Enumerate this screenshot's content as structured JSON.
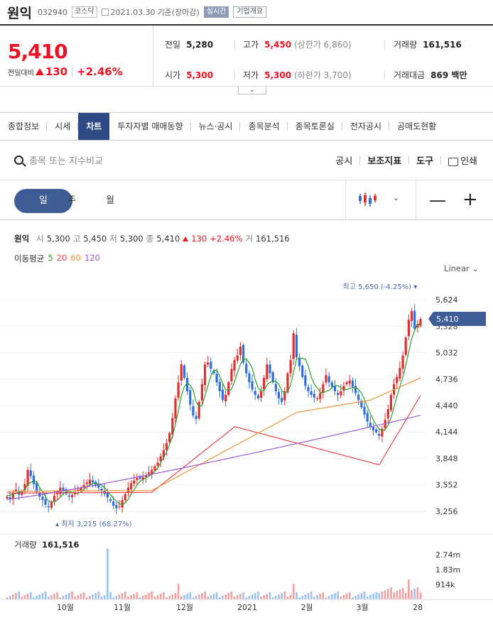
{
  "header": {
    "name": "원익",
    "code": "032940",
    "market": "코스닥",
    "date": "2021.03.30",
    "date_suffix": "기준(장마감)",
    "realtime": "실시간",
    "company_overview": "기업개요"
  },
  "summary": {
    "price": "5,410",
    "change_label": "전일대비",
    "change": "130",
    "change_pct": "+2.46%",
    "prev_close": {
      "label": "전일",
      "value": "5,280"
    },
    "high": {
      "label": "고가",
      "value": "5,450",
      "sub": "(상한가 6,860)"
    },
    "volume": {
      "label": "거래량",
      "value": "161,516"
    },
    "open": {
      "label": "시가",
      "value": "5,300"
    },
    "low": {
      "label": "저가",
      "value": "5,300",
      "sub": "(하한가 3,700)"
    },
    "amount": {
      "label": "거래대금",
      "value": "869 백만"
    }
  },
  "tabs": [
    "종합정보",
    "시세",
    "차트",
    "투자자별 매매동향",
    "뉴스·공시",
    "종목분석",
    "종목토론실",
    "전자공시",
    "공매도현황"
  ],
  "active_tab": "차트",
  "toolbar": {
    "search_placeholder": "종목 또는 지수비교",
    "disclosure": "공시",
    "indicators": "보조지표",
    "tools": "도구",
    "print": "인쇄"
  },
  "period": {
    "day": "일",
    "week": "주",
    "month": "월"
  },
  "chart_info": {
    "name": "원익",
    "open_label": "시",
    "open": "5,300",
    "high_label": "고",
    "high": "5,450",
    "low_label": "저",
    "low": "5,300",
    "close_label": "종",
    "close": "5,410",
    "change": "130",
    "change_pct": "+2.46%",
    "volume_label": "거",
    "volume": "161,516",
    "ma_label": "이동평균",
    "ma": [
      {
        "name": "5",
        "color": "#2aa02a"
      },
      {
        "name": "20",
        "color": "#e2464a"
      },
      {
        "name": "60",
        "color": "#f0953a"
      },
      {
        "name": "120",
        "color": "#9a5ad8"
      }
    ],
    "scale": "Linear"
  },
  "chart_data": {
    "type": "candlestick",
    "y_ticks": [
      "5,624",
      "5,328",
      "5,032",
      "4,736",
      "4,440",
      "4,144",
      "3,848",
      "3,552",
      "3,256"
    ],
    "y_tick_values": [
      5624,
      5328,
      5032,
      4736,
      4440,
      4144,
      3848,
      3552,
      3256
    ],
    "ylim": [
      3120,
      5800
    ],
    "x_labels": [
      "10월",
      "11월",
      "12월",
      "2021",
      "2월",
      "3월",
      "28"
    ],
    "current_price_label": "5,410",
    "current_price": 5410,
    "max_label": "최고 5,650 (-4.25%)",
    "min_label": "최저 3,215 (68.27%)",
    "volume_title": "거래량",
    "volume_value": "161,516",
    "volume_ticks": [
      "2.74m",
      "1.83m",
      "914k"
    ],
    "up_color": "#e12e2e",
    "down_color": "#2f6fd6",
    "closes": [
      3420,
      3390,
      3460,
      3500,
      3440,
      3480,
      3560,
      3720,
      3650,
      3560,
      3470,
      3420,
      3380,
      3330,
      3300,
      3360,
      3430,
      3460,
      3520,
      3490,
      3450,
      3420,
      3440,
      3470,
      3500,
      3520,
      3550,
      3580,
      3610,
      3580,
      3540,
      3520,
      3490,
      3450,
      3410,
      3370,
      3320,
      3290,
      3310,
      3380,
      3450,
      3520,
      3570,
      3600,
      3630,
      3620,
      3640,
      3660,
      3690,
      3720,
      3760,
      3800,
      3870,
      3940,
      4020,
      4130,
      4300,
      4520,
      4700,
      4900,
      4750,
      4600,
      4450,
      4330,
      4290,
      4480,
      4680,
      4900,
      4920,
      4850,
      4800,
      4700,
      4600,
      4500,
      4560,
      4700,
      4850,
      4950,
      5000,
      5100,
      4920,
      4800,
      4700,
      4620,
      4560,
      4520,
      4600,
      4750,
      4900,
      4800,
      4700,
      4600,
      4520,
      4480,
      4600,
      4800,
      4950,
      5250,
      4980,
      4880,
      4760,
      4660,
      4600,
      4560,
      4530,
      4520,
      4580,
      4680,
      4780,
      4700,
      4650,
      4600,
      4560,
      4600,
      4660,
      4700,
      4720,
      4650,
      4580,
      4500,
      4420,
      4340,
      4260,
      4200,
      4160,
      4140,
      4100,
      4180,
      4280,
      4400,
      4560,
      4680,
      4760,
      4860,
      5000,
      5200,
      5400,
      5500,
      5300,
      5350,
      5410
    ],
    "ma5": [
      3430,
      3435,
      3445,
      3460,
      3470,
      3470,
      3500,
      3560,
      3580,
      3600,
      3590,
      3520,
      3480,
      3420,
      3370,
      3360,
      3360,
      3380,
      3410,
      3450,
      3470,
      3470,
      3470,
      3460,
      3460,
      3470,
      3500,
      3530,
      3550,
      3570,
      3570,
      3560,
      3550,
      3520,
      3480,
      3440,
      3400,
      3370,
      3340,
      3330,
      3350,
      3390,
      3450,
      3500,
      3550,
      3590,
      3610,
      3630,
      3650,
      3670,
      3700,
      3740,
      3800,
      3860,
      3920,
      4000,
      4100,
      4230,
      4380,
      4550,
      4650,
      4690,
      4670,
      4610,
      4480,
      4430,
      4440,
      4550,
      4660,
      4770,
      4830,
      4840,
      4770,
      4690,
      4620,
      4610,
      4620,
      4710,
      4810,
      4900,
      4960,
      4960,
      4920,
      4860,
      4730,
      4640,
      4600,
      4610,
      4670,
      4700,
      4710,
      4710,
      4680,
      4610,
      4580,
      4600,
      4670,
      4810,
      4960,
      4970,
      4970,
      4960,
      4880,
      4760,
      4680,
      4640,
      4590,
      4580,
      4600,
      4610,
      4640,
      4660,
      4660,
      4640,
      4620,
      4620,
      4630,
      4640,
      4640,
      4620,
      4580,
      4510,
      4430,
      4350,
      4280,
      4220,
      4180,
      4160,
      4170,
      4220,
      4300,
      4420,
      4540,
      4650,
      4760,
      4890,
      5040,
      5190,
      5280,
      5350,
      5350
    ],
    "ma20_start": 3460,
    "ma20_end": 4570,
    "ma60_start": 3480,
    "ma60_end": 4760,
    "ma120_start": 3390,
    "ma120_end": 4330
  }
}
